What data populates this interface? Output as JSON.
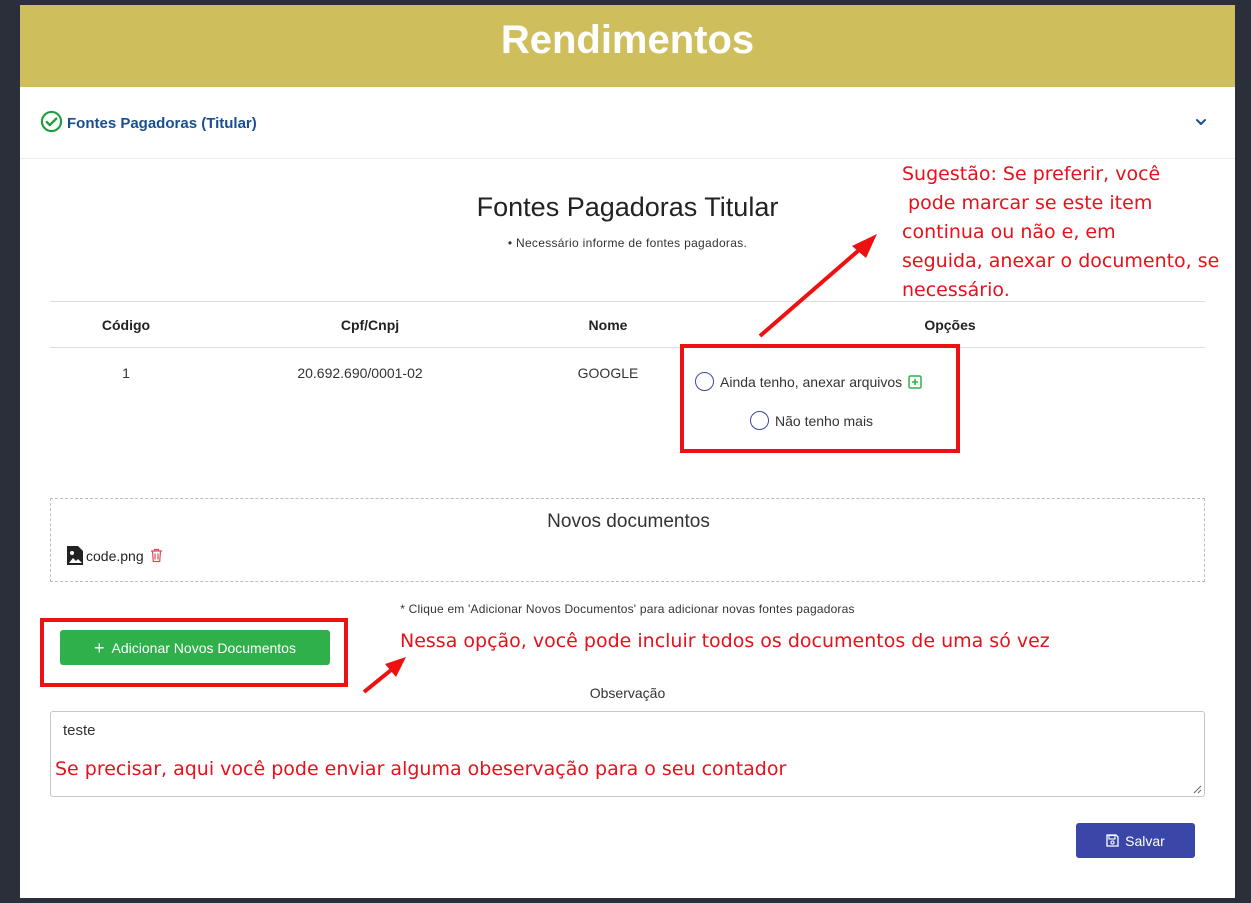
{
  "banner": {
    "title": "Rendimentos"
  },
  "accordion": {
    "title": "Fontes Pagadoras (Titular)"
  },
  "section": {
    "title": "Fontes Pagadoras Titular",
    "subtitle": "• Necessário informe de fontes pagadoras."
  },
  "table": {
    "headers": [
      "Código",
      "Cpf/Cnpj",
      "Nome",
      "Opções"
    ],
    "rows": [
      {
        "codigo": "1",
        "cpf": "20.692.690/0001-02",
        "nome": "GOOGLE"
      }
    ],
    "options": {
      "keep": "Ainda tenho, anexar arquivos",
      "remove": "Não tenho mais"
    }
  },
  "documents": {
    "title": "Novos documentos",
    "files": [
      "code.png"
    ]
  },
  "hint": "* Clique em 'Adicionar Novos Documentos' para adicionar novas fontes pagadoras",
  "add_button": "Adicionar Novos Documentos",
  "observation": {
    "label": "Observação",
    "value": "teste"
  },
  "save_button": "Salvar",
  "annotations": {
    "suggestion": [
      "Sugestão: Se preferir, você",
      " pode marcar se este item",
      "continua ou não e, em",
      "seguida, anexar o documento, se",
      "necessário."
    ],
    "add_note": "Nessa opção, você pode incluir todos os documentos de uma só vez",
    "obs_note": "Se precisar, aqui você pode enviar alguma obeservação para o seu contador"
  },
  "colors": {
    "banner": "#cfbe5c",
    "accordion_title": "#1a4f8f",
    "add_button": "#2fb04a",
    "save_button": "#3a47a8",
    "annotation": "#e8101a"
  }
}
